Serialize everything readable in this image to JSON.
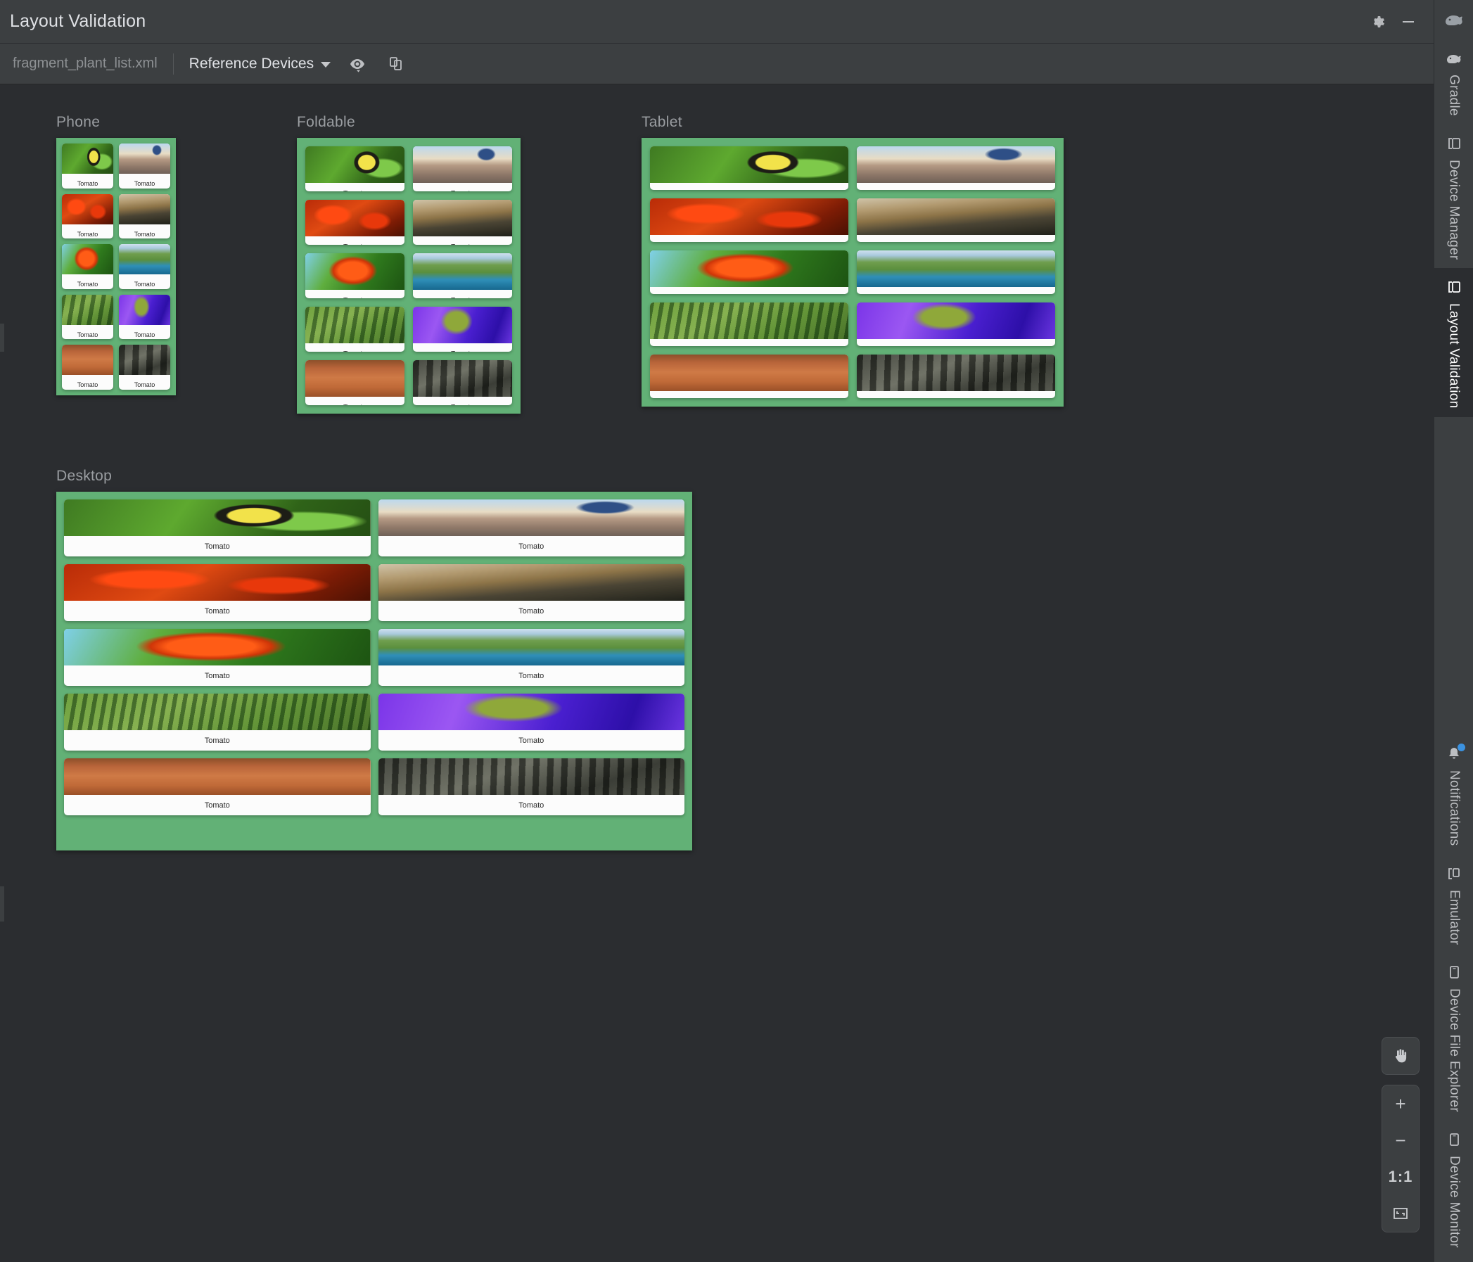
{
  "window": {
    "title": "Layout Validation",
    "settings_icon": "gear-icon",
    "minimize_icon": "minimize-icon"
  },
  "toolbar": {
    "file_name": "fragment_plant_list.xml",
    "device_set_label": "Reference Devices",
    "dropdown_icon": "chevron-down-icon",
    "visibility_icon": "eye-icon",
    "copies_icon": "layers-icon"
  },
  "canvas": {
    "card_label": "Tomato",
    "groups": [
      {
        "label": "Phone",
        "columns": 2
      },
      {
        "label": "Foldable",
        "columns": 2
      },
      {
        "label": "Tablet",
        "columns": 2
      },
      {
        "label": "Desktop",
        "columns": 2
      }
    ],
    "photos": [
      "caterpillar-on-leaf",
      "telescope-over-city",
      "red-maple-leaves",
      "dew-on-branch",
      "orange-leaf-on-green",
      "coastal-aerial-view",
      "aerial-farm-silos",
      "purple-river-rocks",
      "red-desert-mesa",
      "black-white-forest"
    ],
    "accent_green": "#62b176",
    "background": "#2b2d30"
  },
  "zoom_controls": {
    "pan_label": "pan-tool",
    "zoom_in_label": "+",
    "zoom_out_label": "−",
    "actual_size_label": "1:1",
    "fit_label": "zoom-to-fit"
  },
  "right_rail": {
    "top_items": [
      {
        "label": "Gradle",
        "icon": "gradle-elephant-icon",
        "active": false
      },
      {
        "label": "Device Manager",
        "icon": "device-manager-icon",
        "active": false
      },
      {
        "label": "Layout Validation",
        "icon": "layout-validation-icon",
        "active": true
      }
    ],
    "bottom_items": [
      {
        "label": "Notifications",
        "icon": "bell-icon",
        "active": false,
        "badge": true
      },
      {
        "label": "Emulator",
        "icon": "emulator-icon",
        "active": false,
        "badge": false
      },
      {
        "label": "Device File Explorer",
        "icon": "device-file-icon",
        "active": false,
        "badge": false
      },
      {
        "label": "Device Monitor",
        "icon": "device-monitor-icon",
        "active": false,
        "badge": false
      }
    ]
  }
}
